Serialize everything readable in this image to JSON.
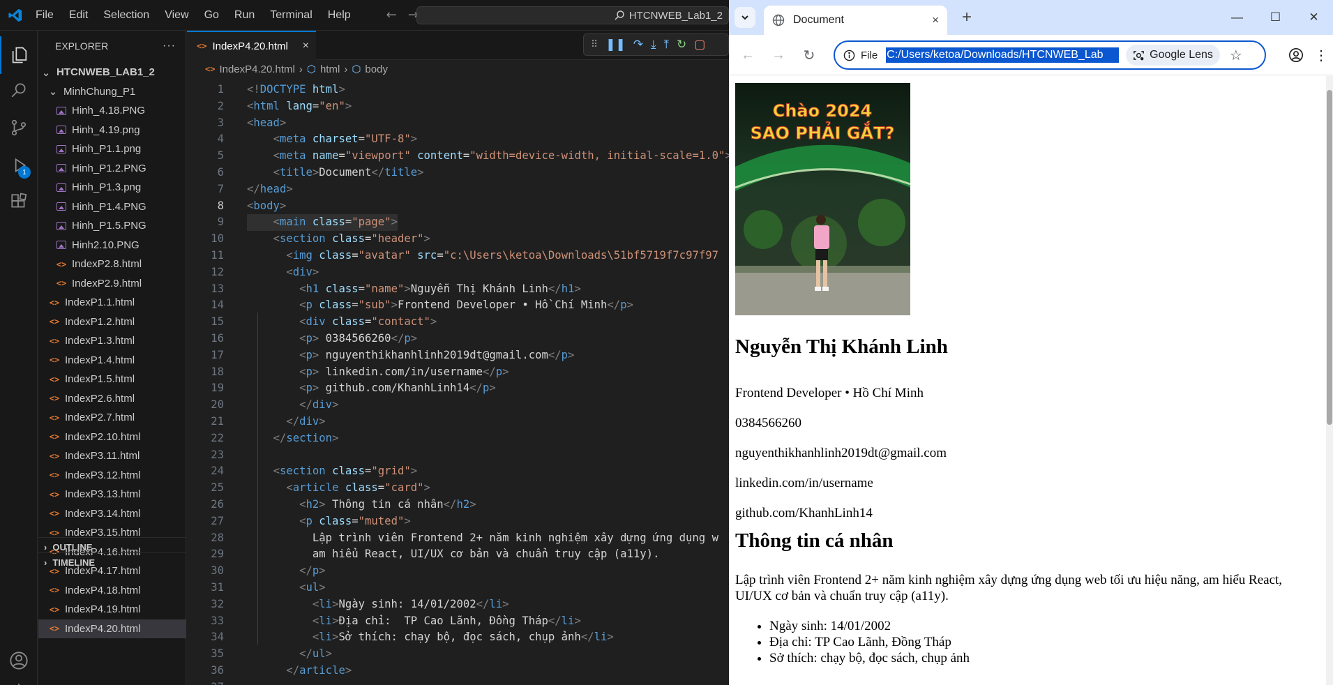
{
  "vscode": {
    "menu": [
      "File",
      "Edit",
      "Selection",
      "View",
      "Go",
      "Run",
      "Terminal",
      "Help"
    ],
    "search_text": "HTCNWEB_Lab1_2",
    "debug_badge": "1",
    "explorer": {
      "title": "EXPLORER",
      "more": "···",
      "root": "HTCNWEB_LAB1_2",
      "folder": "MinhChung_P1",
      "folder_files": [
        "Hinh_4.18.PNG",
        "Hinh_4.19.png",
        "Hinh_P1.1.png",
        "Hinh_P1.2.PNG",
        "Hinh_P1.3.png",
        "Hinh_P1.4.PNG",
        "Hinh_P1.5.PNG",
        "Hinh2.10.PNG",
        "IndexP2.8.html",
        "IndexP2.9.html"
      ],
      "root_files": [
        "IndexP1.1.html",
        "IndexP1.2.html",
        "IndexP1.3.html",
        "IndexP1.4.html",
        "IndexP1.5.html",
        "IndexP2.6.html",
        "IndexP2.7.html",
        "IndexP2.10.html",
        "IndexP3.11.html",
        "IndexP3.12.html",
        "IndexP3.13.html",
        "IndexP3.14.html",
        "IndexP3.15.html",
        "IndexP4.16.html",
        "IndexP4.17.html",
        "IndexP4.18.html",
        "IndexP4.19.html",
        "IndexP4.20.html"
      ],
      "selected_file": "IndexP4.20.html",
      "outline": "OUTLINE",
      "timeline": "TIMELINE"
    },
    "tab": {
      "label": "IndexP4.20.html",
      "close": "×"
    },
    "breadcrumb": {
      "file": "IndexP4.20.html",
      "html": "html",
      "body": "body"
    },
    "current_line": 8,
    "code_lines": [
      "<!DOCTYPE html>",
      "<html lang=\"en\">",
      "<head>",
      "    <meta charset=\"UTF-8\">",
      "    <meta name=\"viewport\" content=\"width=device-width, initial-scale=1.0\">",
      "    <title>Document</title>",
      "</head>",
      "<body>",
      "    <main class=\"page\">",
      "    <section class=\"header\">",
      "      <img class=\"avatar\" src=\"c:\\Users\\ketoa\\Downloads\\51bf5719f7c97f97",
      "      <div>",
      "        <h1 class=\"name\">Nguyễn Thị Khánh Linh</h1>",
      "        <p class=\"sub\">Frontend Developer • Hồ Chí Minh</p>",
      "        <div class=\"contact\">",
      "        <p> 0384566260</p>",
      "        <p> nguyenthikhanhlinh2019dt@gmail.com</p>",
      "        <p> linkedin.com/in/username</p>",
      "        <p> github.com/KhanhLinh14</p>",
      "        </div>",
      "      </div>",
      "    </section>",
      "",
      "    <section class=\"grid\">",
      "      <article class=\"card\">",
      "        <h2> Thông tin cá nhân</h2>",
      "        <p class=\"muted\">",
      "          Lập trình viên Frontend 2+ năm kinh nghiệm xây dựng ứng dụng w",
      "          am hiểu React, UI/UX cơ bản và chuẩn truy cập (a11y).",
      "        </p>",
      "        <ul>",
      "          <li>Ngày sinh: 14/01/2002</li>",
      "          <li>Địa chỉ:  TP Cao Lãnh, Đồng Tháp</li>",
      "          <li>Sở thích: chạy bộ, đọc sách, chụp ảnh</li>",
      "        </ul>",
      "      </article>",
      ""
    ]
  },
  "chrome": {
    "tab_title": "Document",
    "tab_close": "×",
    "new_tab": "+",
    "file_label": "File",
    "url": "C:/Users/ketoa/Downloads/HTCNWEB_Lab",
    "lens_label": "Google Lens",
    "page": {
      "name": "Nguyễn Thị Khánh Linh",
      "sub": "Frontend Developer • Hồ Chí Minh",
      "phone": "0384566260",
      "email": "nguyenthikhanhlinh2019dt@gmail.com",
      "linkedin": "linkedin.com/in/username",
      "github": "github.com/KhanhLinh14",
      "section_title": "Thông tin cá nhân",
      "intro": "Lập trình viên Frontend 2+ năm kinh nghiệm xây dựng ứng dụng web tối ưu hiệu năng, am hiểu React, UI/UX cơ bản và chuẩn truy cập (a11y).",
      "facts": [
        "Ngày sinh: 14/01/2002",
        "Địa chỉ: TP Cao Lãnh, Đồng Tháp",
        "Sở thích: chạy bộ, đọc sách, chụp ảnh"
      ],
      "photo_caption": "Chào 2024 SAO PHẢI GẮT?"
    }
  },
  "colors": {
    "accent": "#0078d4",
    "chrome_accent": "#0b57d0",
    "html_icon": "#e37933",
    "image_icon": "#a074c4"
  }
}
